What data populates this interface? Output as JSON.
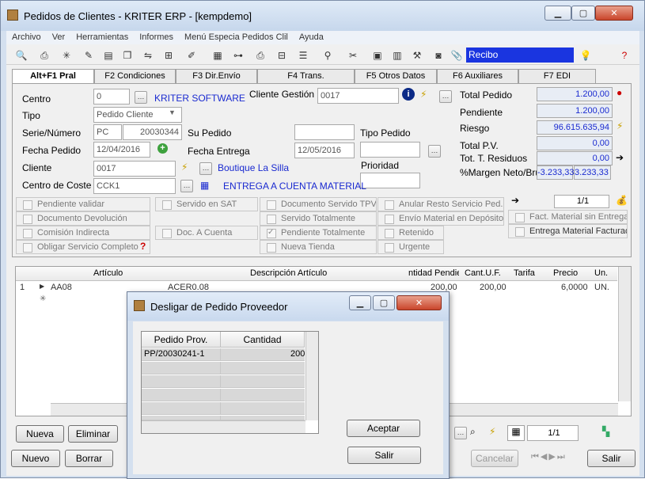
{
  "window": {
    "title": "Pedidos de Clientes - KRITER ERP - [kempdemo]"
  },
  "menu": [
    "Archivo",
    "Ver",
    "Herramientas",
    "Informes",
    "Menú Especia Pedidos Clil",
    "Ayuda"
  ],
  "toolbar": {
    "combo_value": "Recibo"
  },
  "tabs": [
    "Alt+F1 Pral",
    "F2 Condiciones",
    "F3 Dir.Envío",
    "F4 Trans.",
    "F5 Otros Datos",
    "F6 Auxiliares",
    "F7 EDI"
  ],
  "form": {
    "centro_label": "Centro",
    "centro_value": "0",
    "centro_name": "KRITER SOFTWARE",
    "cliente_gestion_label": "Cliente Gestión",
    "cliente_gestion_value": "0017",
    "tipo_label": "Tipo",
    "tipo_value": "Pedido Cliente",
    "serie_label": "Serie/Número",
    "serie_value": "PC",
    "numero_value": "20030344",
    "su_pedido_label": "Su Pedido",
    "su_pedido_value": "",
    "tipo_pedido_label": "Tipo Pedido",
    "tipo_pedido_value": "",
    "fecha_pedido_label": "Fecha Pedido",
    "fecha_pedido_value": "12/04/2016",
    "fecha_entrega_label": "Fecha Entrega",
    "fecha_entrega_value": "12/05/2016",
    "prioridad_label": "Prioridad",
    "prioridad_value": "",
    "cliente_label": "Cliente",
    "cliente_value": "0017",
    "cliente_name": "Boutique La Silla",
    "centro_coste_label": "Centro de Coste",
    "centro_coste_value": "CCK1",
    "entrega_text": "ENTREGA A CUENTA MATERIAL"
  },
  "totals": {
    "total_pedido_label": "Total Pedido",
    "total_pedido": "1.200,00",
    "pendiente_label": "Pendiente",
    "pendiente": "1.200,00",
    "riesgo_label": "Riesgo",
    "riesgo": "96.615.635,94",
    "total_pv_label": "Total P.V.",
    "total_pv": "0,00",
    "tot_residuos_label": "Tot. T. Residuos",
    "tot_residuos": "0,00",
    "margen_label": "%Margen Neto/Bru",
    "margen_neto": "-3.233,33",
    "margen_bruto": "3.233,33",
    "pager": "1/1"
  },
  "checkboxes": {
    "col1": [
      "Pendiente validar",
      "Documento Devolución",
      "Comisión Indirecta",
      "Obligar Servicio Completo"
    ],
    "col2": [
      "Servido en SAT",
      "Doc. A Cuenta"
    ],
    "col3": [
      "Documento Servido TPV",
      "Servido Totalmente",
      "Pendiente Totalmente",
      "Nueva Tienda"
    ],
    "col4": [
      "Anular Resto Servicio Ped.",
      "Envío Material en Depósito",
      "Retenido",
      "Urgente"
    ],
    "col5": [
      "Fact. Material sin Entrega",
      "Entrega Material Facturad"
    ]
  },
  "grid": {
    "headers": [
      "Artículo",
      "Descripción Artículo",
      "ntidad Pendie",
      "Cant.U.F.",
      "Tarifa",
      "Precio",
      "Un."
    ],
    "row": {
      "num": "1",
      "articulo": "AA08",
      "descripcion": "ACER0.08",
      "cantidad": "200,00",
      "cant_uf": "200,00",
      "tarifa": "",
      "precio": "6,0000",
      "un": "UN."
    },
    "pager": "1/1"
  },
  "buttons": {
    "nueva": "Nueva",
    "eliminar": "Eliminar",
    "nuevo": "Nuevo",
    "borrar": "Borrar",
    "cancelar": "Cancelar",
    "salir": "Salir"
  },
  "dialog": {
    "title": "Desligar de Pedido Proveedor",
    "headers": [
      "Pedido Prov.",
      "Cantidad"
    ],
    "row": {
      "pedido": "PP/20030241-1",
      "cantidad": "200"
    },
    "aceptar": "Aceptar",
    "salir": "Salir"
  }
}
